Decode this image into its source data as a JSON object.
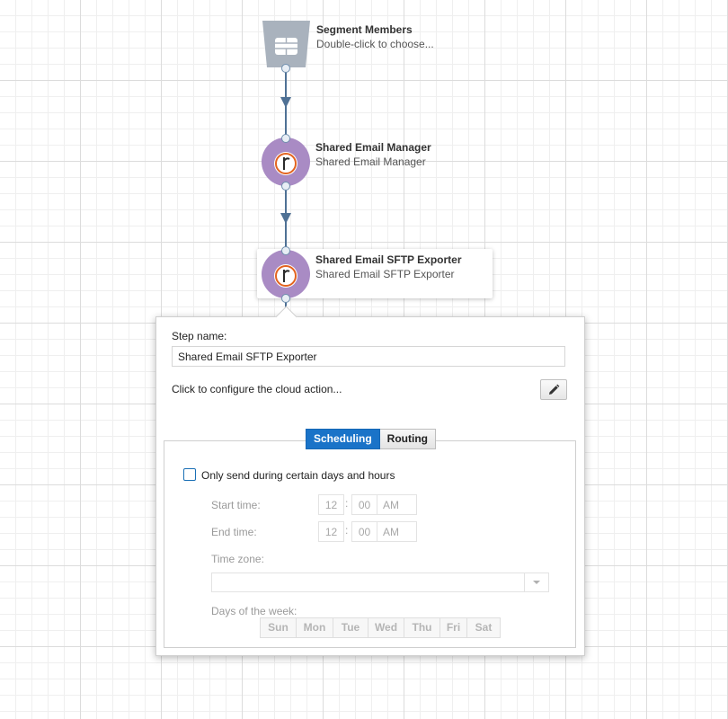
{
  "nodes": [
    {
      "title": "Segment Members",
      "subtitle": "Double-click to choose...",
      "icon": "database-icon"
    },
    {
      "title": "Shared Email Manager",
      "subtitle": "Shared Email Manager",
      "icon": "responsys-logo-icon"
    },
    {
      "title": "Shared Email SFTP Exporter",
      "subtitle": "Shared Email SFTP Exporter",
      "icon": "responsys-logo-icon"
    }
  ],
  "colors": {
    "segment_icon": "#a9b2bd",
    "action_node": "#a98bc4",
    "connector": "#4f7195",
    "active_tab": "#1a73c8"
  },
  "popover": {
    "step_name_label": "Step name:",
    "step_name_value": "Shared Email SFTP Exporter",
    "configure_text": "Click to configure the cloud action...",
    "tabs": [
      {
        "label": "Scheduling",
        "active": true
      },
      {
        "label": "Routing",
        "active": false
      }
    ],
    "scheduling": {
      "checkbox_label": "Only send during certain days and hours",
      "checked": false,
      "start_time_label": "Start time:",
      "start_hour": "12",
      "start_minute": "00",
      "start_ampm": "AM",
      "end_time_label": "End time:",
      "end_hour": "12",
      "end_minute": "00",
      "end_ampm": "AM",
      "time_sep": ":",
      "time_zone_label": "Time zone:",
      "time_zone_value": "",
      "days_label": "Days of the week:",
      "days": [
        "Sun",
        "Mon",
        "Tue",
        "Wed",
        "Thu",
        "Fri",
        "Sat"
      ]
    }
  }
}
